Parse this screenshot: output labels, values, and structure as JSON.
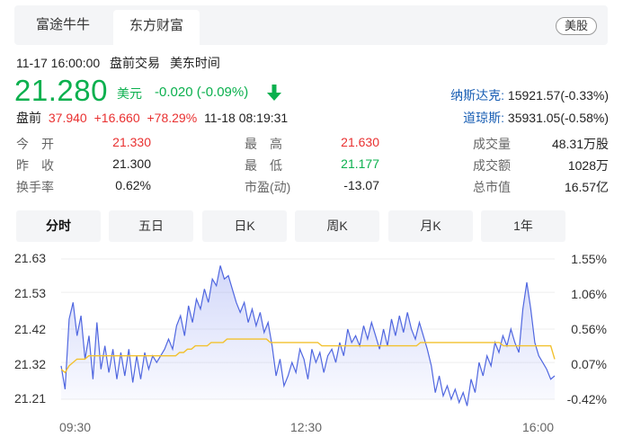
{
  "tabs": [
    {
      "label": "富途牛牛"
    },
    {
      "label": "东方财富"
    }
  ],
  "market_badge": "美股",
  "status": {
    "datetime": "11-17 16:00:00",
    "session": "盘前交易",
    "timezone": "美东时间"
  },
  "quote": {
    "price": "21.280",
    "currency": "美元",
    "change": "-0.020 (-0.09%)"
  },
  "indices": [
    {
      "name": "纳斯达克:",
      "value": "15921.57(-0.33%)"
    },
    {
      "name": "道琼斯:",
      "value": "35931.05(-0.58%)"
    }
  ],
  "premarket": {
    "label": "盘前",
    "price": "37.940",
    "change": "+16.660",
    "percent": "+78.29%",
    "time": "11-18 08:19:31"
  },
  "stats": {
    "open": {
      "label": "今　开",
      "value": "21.330"
    },
    "prev_close": {
      "label": "昨　收",
      "value": "21.300"
    },
    "turnover_rate": {
      "label": "换手率",
      "value": "0.62%"
    },
    "high": {
      "label": "最　高",
      "value": "21.630"
    },
    "low": {
      "label": "最　低",
      "value": "21.177"
    },
    "pe": {
      "label": "市盈(动)",
      "value": "-13.07"
    },
    "volume": {
      "label": "成交量",
      "value": "48.31万股"
    },
    "amount": {
      "label": "成交额",
      "value": "1028万"
    },
    "market_cap": {
      "label": "总市值",
      "value": "16.57亿"
    }
  },
  "periods": [
    "分时",
    "五日",
    "日K",
    "周K",
    "月K",
    "1年"
  ],
  "colors": {
    "up": "#e93030",
    "down": "#0bb04e",
    "price_line": "#5067e0",
    "avg_line": "#f2c12e",
    "link": "#1a5fb4"
  },
  "chart_data": {
    "type": "area",
    "y_ticks": [
      "21.63",
      "21.53",
      "21.42",
      "21.32",
      "21.21"
    ],
    "y_pct_ticks": [
      "1.55%",
      "1.06%",
      "0.56%",
      "0.07%",
      "-0.42%"
    ],
    "x_ticks": [
      "09:30",
      "12:30",
      "16:00"
    ],
    "ylim": [
      21.21,
      21.63
    ],
    "prev_close": 21.3,
    "series": [
      {
        "values": [
          21.31,
          21.24,
          21.45,
          21.5,
          21.4,
          21.46,
          21.33,
          21.4,
          21.27,
          21.44,
          21.3,
          21.37,
          21.29,
          21.36,
          21.27,
          21.35,
          21.28,
          21.36,
          21.26,
          21.34,
          21.27,
          21.35,
          21.3,
          21.34,
          21.32,
          21.34,
          21.36,
          21.39,
          21.36,
          21.43,
          21.46,
          21.4,
          21.49,
          21.44,
          21.51,
          21.48,
          21.54,
          21.5,
          21.57,
          21.55,
          21.61,
          21.57,
          21.58,
          21.54,
          21.5,
          21.47,
          21.5,
          21.44,
          21.48,
          21.43,
          21.47,
          21.41,
          21.44,
          21.37,
          21.28,
          21.33,
          21.25,
          21.28,
          21.32,
          21.29,
          21.36,
          21.33,
          21.27,
          21.36,
          21.32,
          21.35,
          21.29,
          21.34,
          21.36,
          21.32,
          21.38,
          21.34,
          21.42,
          21.38,
          21.4,
          21.37,
          21.43,
          21.39,
          21.44,
          21.4,
          21.36,
          21.42,
          21.37,
          21.45,
          21.4,
          21.46,
          21.41,
          21.47,
          21.42,
          21.39,
          21.44,
          21.4,
          21.36,
          21.31,
          21.23,
          21.28,
          21.22,
          21.25,
          21.21,
          21.24,
          21.2,
          21.23,
          21.19,
          21.27,
          21.23,
          21.32,
          21.28,
          21.34,
          21.31,
          21.38,
          21.35,
          21.4,
          21.37,
          21.42,
          21.38,
          21.35,
          21.48,
          21.56,
          21.48,
          21.38,
          21.34,
          21.32,
          21.3,
          21.27,
          21.28
        ],
        "name": ""
      },
      {
        "values": [
          21.3,
          21.29,
          21.31,
          21.32,
          21.33,
          21.33,
          21.33,
          21.34,
          21.34,
          21.34,
          21.34,
          21.34,
          21.34,
          21.34,
          21.34,
          21.34,
          21.34,
          21.34,
          21.34,
          21.34,
          21.34,
          21.34,
          21.34,
          21.34,
          21.34,
          21.34,
          21.34,
          21.34,
          21.34,
          21.34,
          21.35,
          21.35,
          21.36,
          21.36,
          21.37,
          21.37,
          21.37,
          21.37,
          21.38,
          21.38,
          21.38,
          21.38,
          21.39,
          21.39,
          21.39,
          21.39,
          21.39,
          21.39,
          21.39,
          21.39,
          21.39,
          21.39,
          21.39,
          21.38,
          21.38,
          21.38,
          21.38,
          21.38,
          21.38,
          21.38,
          21.38,
          21.38,
          21.38,
          21.38,
          21.38,
          21.38,
          21.37,
          21.37,
          21.37,
          21.37,
          21.37,
          21.37,
          21.37,
          21.37,
          21.37,
          21.37,
          21.37,
          21.37,
          21.37,
          21.37,
          21.37,
          21.37,
          21.37,
          21.37,
          21.37,
          21.37,
          21.37,
          21.37,
          21.37,
          21.37,
          21.37,
          21.38,
          21.38,
          21.38,
          21.38,
          21.38,
          21.38,
          21.38,
          21.38,
          21.38,
          21.38,
          21.38,
          21.38,
          21.38,
          21.38,
          21.38,
          21.38,
          21.38,
          21.38,
          21.38,
          21.38,
          21.38,
          21.37,
          21.37,
          21.37,
          21.37,
          21.37,
          21.37,
          21.37,
          21.37,
          21.37,
          21.37,
          21.37,
          21.37,
          21.37,
          21.33
        ],
        "name": ""
      }
    ]
  }
}
